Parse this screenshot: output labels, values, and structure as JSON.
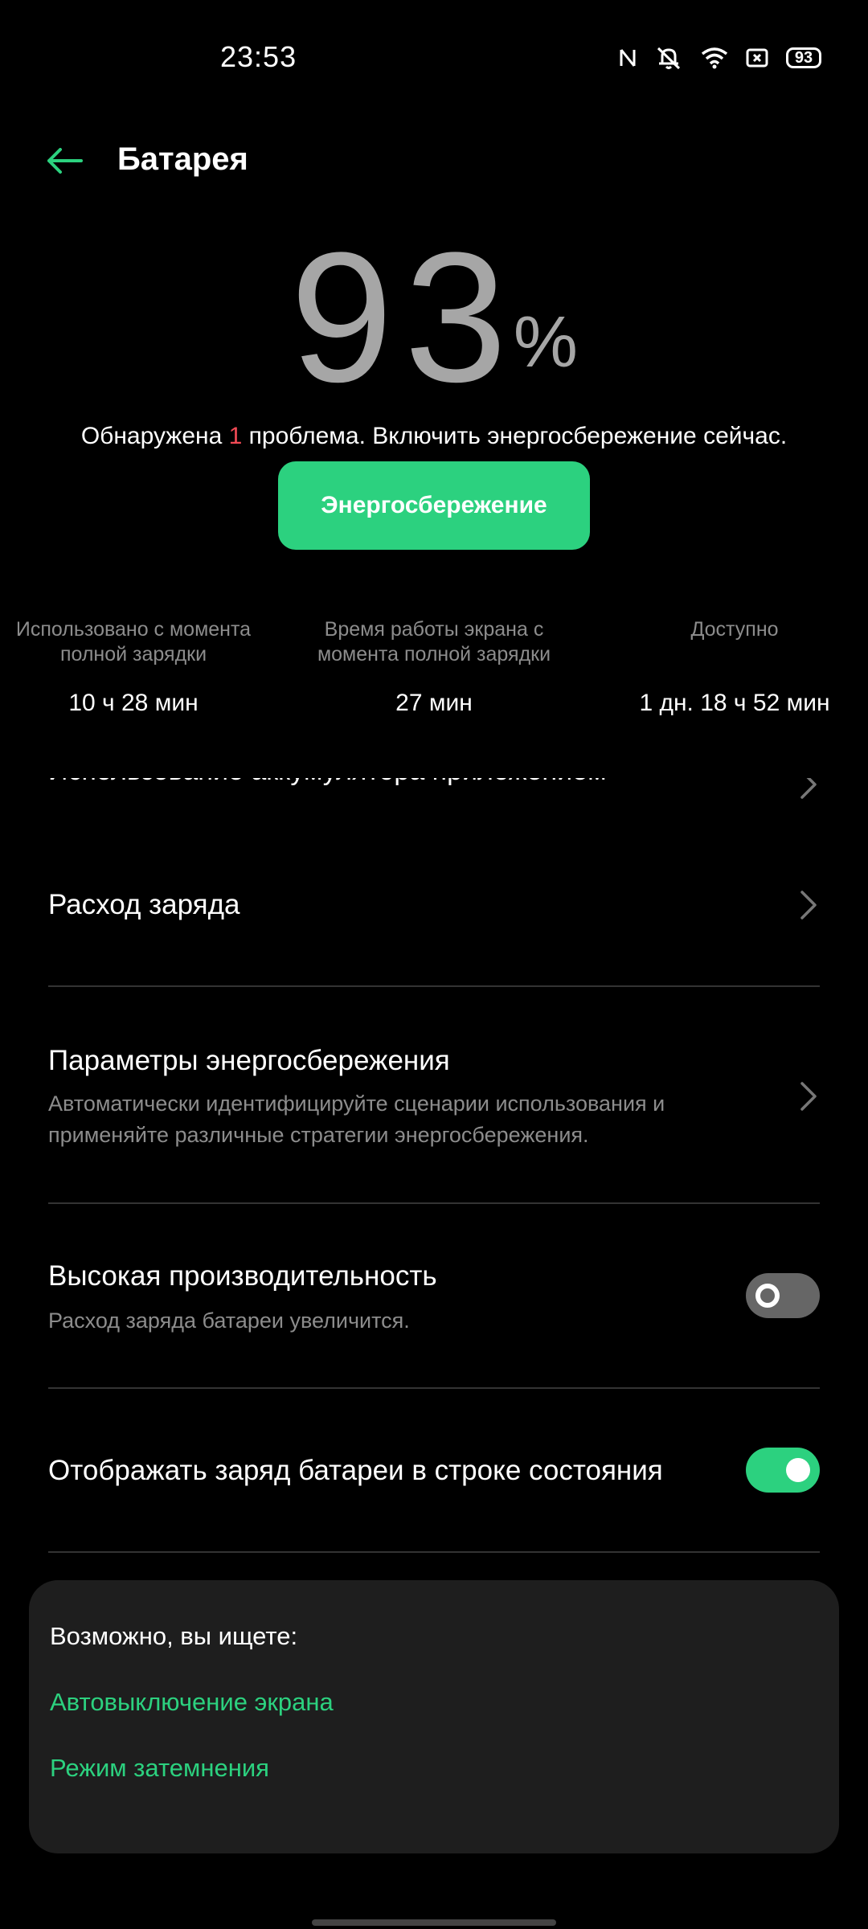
{
  "status_bar": {
    "time": "23:53",
    "battery_level": "93",
    "icons": [
      "nfc-icon",
      "mute-icon",
      "wifi-icon",
      "dnd-icon",
      "battery-icon"
    ]
  },
  "header": {
    "back_icon": "arrow-left-icon",
    "title": "Батарея"
  },
  "battery": {
    "percent": "93",
    "percent_sign": "%",
    "problem_prefix": "Обнаружена ",
    "problem_count": "1",
    "problem_suffix": " проблема. Включить энергосбережение сейчас.",
    "saver_button": "Энергосбережение"
  },
  "stats": [
    {
      "label_line1": "Использовано с момента",
      "label_line2": "полной зарядки",
      "value": "10 ч 28 мин"
    },
    {
      "label_line1": "Время работы экрана с",
      "label_line2": "момента полной зарядки",
      "value": "27 мин"
    },
    {
      "label_line1": "Доступно",
      "label_line2": "",
      "value": "1 дн. 18 ч 52 мин"
    }
  ],
  "list": {
    "clipped_item": "Использование аккумулятора приложением",
    "charge_usage": {
      "title": "Расход заряда"
    },
    "power_saving_params": {
      "title": "Параметры энергосбережения",
      "subtitle_line1": "Автоматически идентифицируйте сценарии использования и",
      "subtitle_line2": "применяйте различные стратегии энергосбережения."
    },
    "high_performance": {
      "title": "Высокая производительность",
      "subtitle": "Расход заряда батареи увеличится.",
      "enabled": false
    },
    "show_battery_status": {
      "title": "Отображать заряд батареи в строке состояния",
      "enabled": true
    }
  },
  "suggestions": {
    "title": "Возможно, вы ищете:",
    "links": [
      "Автовыключение экрана",
      "Режим затемнения"
    ]
  },
  "colors": {
    "accent": "#2cd17f",
    "alert": "#f24a55",
    "background": "#000000",
    "card": "#1e1e1e",
    "secondary_text": "#8c8c8c"
  }
}
